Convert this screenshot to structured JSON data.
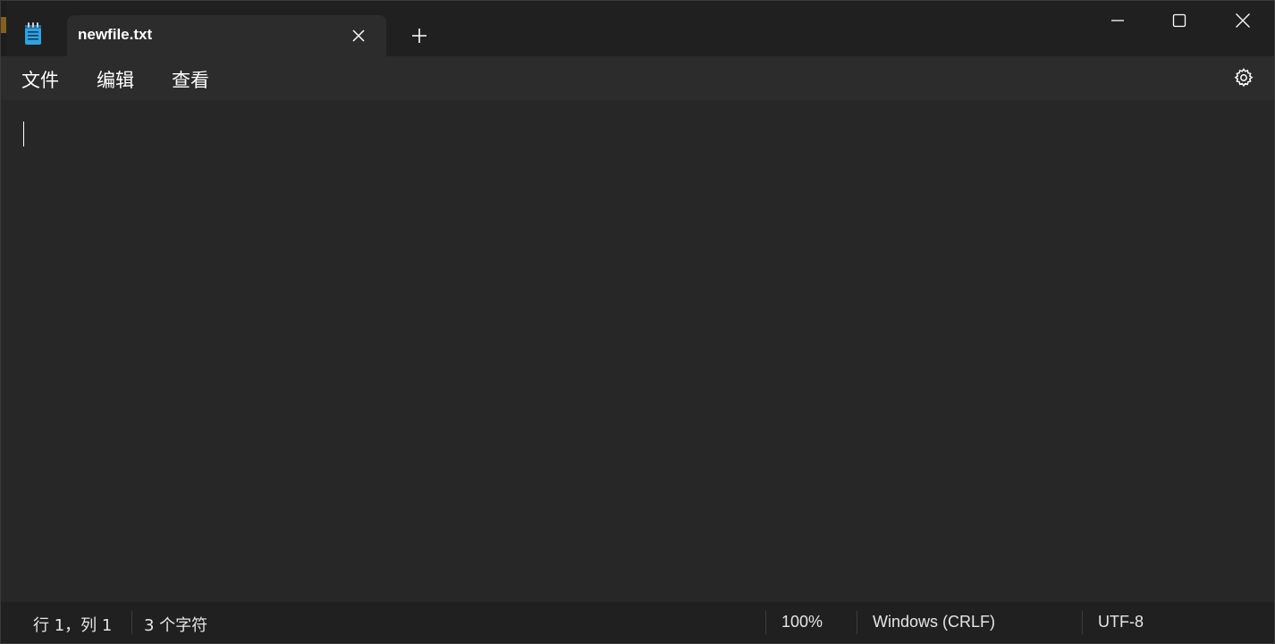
{
  "tab": {
    "title": "newfile.txt"
  },
  "menu": {
    "file": "文件",
    "edit": "编辑",
    "view": "查看"
  },
  "editor": {
    "content": ""
  },
  "status": {
    "position": "行 1，列 1",
    "char_count": "3 个字符",
    "zoom": "100%",
    "line_ending": "Windows (CRLF)",
    "encoding": "UTF-8"
  },
  "icons": {
    "app": "notepad-icon",
    "tab_close": "close-icon",
    "new_tab": "plus-icon",
    "minimize": "minimize-icon",
    "maximize": "maximize-icon",
    "close": "close-icon",
    "settings": "gear-icon"
  },
  "colors": {
    "titlebar": "#202020",
    "tab": "#2c2c2c",
    "editor": "#272727",
    "text": "#ffffff"
  }
}
